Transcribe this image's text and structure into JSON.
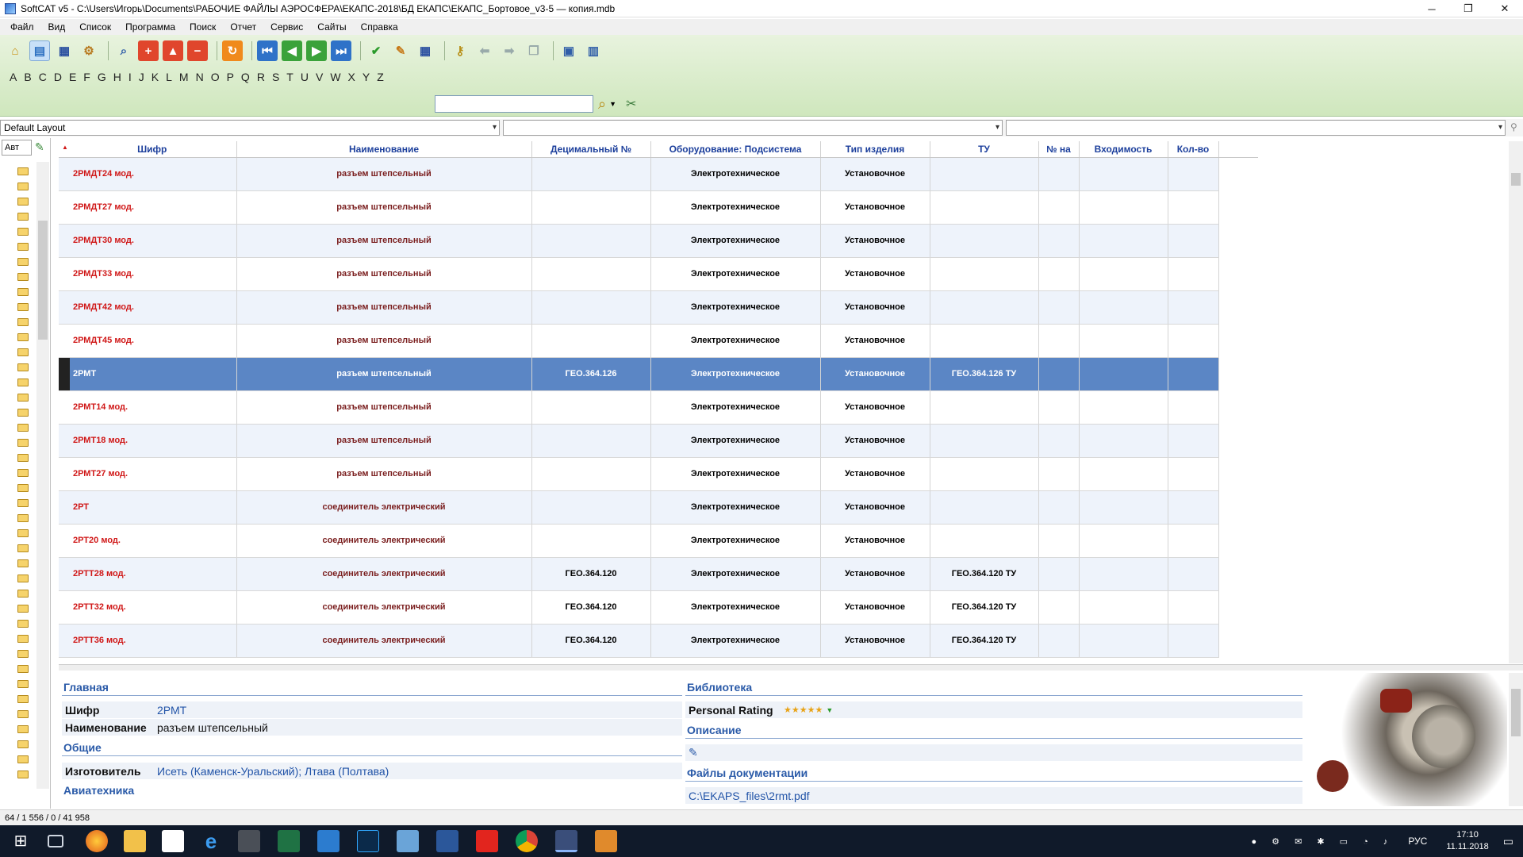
{
  "window": {
    "title": "SoftCAT v5 - C:\\Users\\Игорь\\Documents\\РАБОЧИЕ ФАЙЛЫ АЭРОСФЕРА\\ЕКАПС-2018\\БД ЕКАПС\\ЕКАПС_Бортовое_v3-5 — копия.mdb",
    "minimize": "─",
    "maximize": "❐",
    "close": "✕"
  },
  "menu": [
    "Файл",
    "Вид",
    "Список",
    "Программа",
    "Поиск",
    "Отчет",
    "Сервис",
    "Сайты",
    "Справка"
  ],
  "toolbar": {
    "icons": [
      "folder-open-icon",
      "database-icon",
      "table-icon",
      "settings-icon",
      "magnifier-icon",
      "add-red-icon",
      "up-red-icon",
      "remove-red-icon",
      "refresh-icon",
      "first-record-icon",
      "prev-record-icon",
      "next-record-icon",
      "last-record-icon",
      "checkmark-icon",
      "edit-checklist-icon",
      "grid-view-icon",
      "key-icon",
      "back-arrow-icon",
      "forward-arrow-icon",
      "windows-icon",
      "document-icon",
      "chart-icon"
    ]
  },
  "alphabet": [
    "A",
    "B",
    "C",
    "D",
    "E",
    "F",
    "G",
    "H",
    "I",
    "J",
    "K",
    "L",
    "M",
    "N",
    "O",
    "P",
    "Q",
    "R",
    "S",
    "T",
    "U",
    "V",
    "W",
    "X",
    "Y",
    "Z"
  ],
  "search": {
    "value": ""
  },
  "layout": {
    "selected": "Default Layout",
    "filter1": "",
    "filter2": ""
  },
  "leftpanel": {
    "combo": "Авт"
  },
  "grid": {
    "columns": [
      "Шифр",
      "Наименование",
      "Децимальный №",
      "Оборудование: Подсистема",
      "Тип изделия",
      "ТУ",
      "№ на",
      "Входимость",
      "Кол-во"
    ],
    "rows": [
      {
        "code": "2РМДТ24 мод.",
        "name": "разъем штепсельный",
        "dec": "",
        "equip": "Электротехническое",
        "type": "Установочное",
        "tu": ""
      },
      {
        "code": "2РМДТ27 мод.",
        "name": "разъем штепсельный",
        "dec": "",
        "equip": "Электротехническое",
        "type": "Установочное",
        "tu": ""
      },
      {
        "code": "2РМДТ30 мод.",
        "name": "разъем штепсельный",
        "dec": "",
        "equip": "Электротехническое",
        "type": "Установочное",
        "tu": ""
      },
      {
        "code": "2РМДТ33 мод.",
        "name": "разъем штепсельный",
        "dec": "",
        "equip": "Электротехническое",
        "type": "Установочное",
        "tu": ""
      },
      {
        "code": "2РМДТ42 мод.",
        "name": "разъем штепсельный",
        "dec": "",
        "equip": "Электротехническое",
        "type": "Установочное",
        "tu": ""
      },
      {
        "code": "2РМДТ45 мод.",
        "name": "разъем штепсельный",
        "dec": "",
        "equip": "Электротехническое",
        "type": "Установочное",
        "tu": ""
      },
      {
        "code": "2РМТ",
        "name": "разъем штепсельный",
        "dec": "ГЕО.364.126",
        "equip": "Электротехническое",
        "type": "Установочное",
        "tu": "ГЕО.364.126 ТУ"
      },
      {
        "code": "2РМТ14 мод.",
        "name": "разъем штепсельный",
        "dec": "",
        "equip": "Электротехническое",
        "type": "Установочное",
        "tu": ""
      },
      {
        "code": "2РМТ18 мод.",
        "name": "разъем штепсельный",
        "dec": "",
        "equip": "Электротехническое",
        "type": "Установочное",
        "tu": ""
      },
      {
        "code": "2РМТ27 мод.",
        "name": "разъем штепсельный",
        "dec": "",
        "equip": "Электротехническое",
        "type": "Установочное",
        "tu": ""
      },
      {
        "code": "2РТ",
        "name": "соединитель электрический",
        "dec": "",
        "equip": "Электротехническое",
        "type": "Установочное",
        "tu": ""
      },
      {
        "code": "2РТ20 мод.",
        "name": "соединитель электрический",
        "dec": "",
        "equip": "Электротехническое",
        "type": "Установочное",
        "tu": ""
      },
      {
        "code": "2РТТ28 мод.",
        "name": "соединитель электрический",
        "dec": "ГЕО.364.120",
        "equip": "Электротехническое",
        "type": "Установочное",
        "tu": "ГЕО.364.120 ТУ"
      },
      {
        "code": "2РТТ32 мод.",
        "name": "соединитель электрический",
        "dec": "ГЕО.364.120",
        "equip": "Электротехническое",
        "type": "Установочное",
        "tu": "ГЕО.364.120 ТУ"
      },
      {
        "code": "2РТТ36 мод.",
        "name": "соединитель электрический",
        "dec": "ГЕО.364.120",
        "equip": "Электротехническое",
        "type": "Установочное",
        "tu": "ГЕО.364.120 ТУ"
      }
    ],
    "selected_index": 6
  },
  "details": {
    "main_title": "Главная",
    "code_label": "Шифр",
    "code_value": "2РМТ",
    "name_label": "Наименование",
    "name_value": "разъем штепсельный",
    "general_title": "Общие",
    "maker_label": "Изготовитель",
    "maker_value": "Исеть (Каменск-Уральский); Лтава (Полтава)",
    "avia_title": "Авиатехника",
    "library_title": "Библиотека",
    "rating_label": "Personal Rating",
    "rating_stars": "★★★★★",
    "description_title": "Описание",
    "files_title": "Файлы документации",
    "file_link": "C:\\EKAPS_files\\2rmt.pdf"
  },
  "status": {
    "text": "64 / 1 556 / 0 / 41 958"
  },
  "taskbar": {
    "lang": "РУС",
    "time": "17:10",
    "date": "11.11.2018"
  }
}
